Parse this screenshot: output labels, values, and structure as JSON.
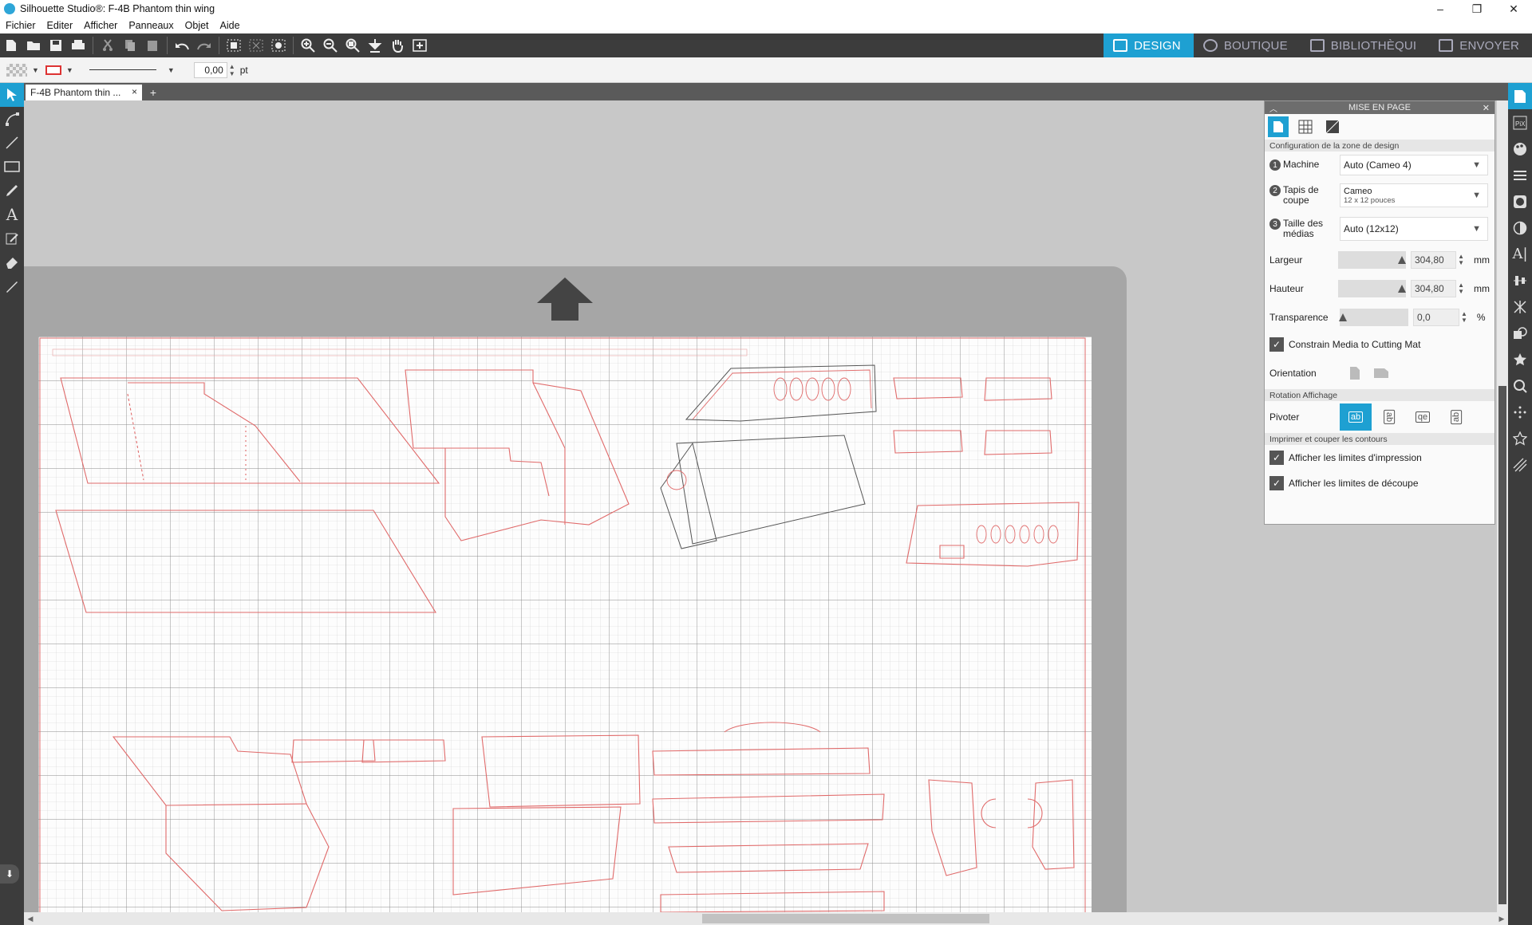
{
  "window": {
    "title": "Silhouette Studio®: F-4B Phantom thin wing",
    "controls": [
      "–",
      "❐",
      "✕"
    ]
  },
  "menu": [
    "Fichier",
    "Editer",
    "Afficher",
    "Panneaux",
    "Objet",
    "Aide"
  ],
  "nav": {
    "tabs": [
      {
        "label": "DESIGN",
        "active": true
      },
      {
        "label": "BOUTIQUE",
        "active": false
      },
      {
        "label": "BIBLIOTHÈQUI",
        "active": false
      },
      {
        "label": "ENVOYER",
        "active": false
      }
    ]
  },
  "properties": {
    "line_width": "0,00",
    "line_unit": "pt"
  },
  "document": {
    "tab_label": "F-4B Phantom thin ...",
    "close": "×",
    "add": "+"
  },
  "panel": {
    "title": "MISE EN PAGE",
    "section_design": "Configuration de la zone de design",
    "machine": {
      "step": "1",
      "label": "Machine",
      "value": "Auto (Cameo 4)"
    },
    "mat": {
      "step": "2",
      "label": "Tapis de coupe",
      "value": "Cameo",
      "sub": "12 x 12 pouces"
    },
    "media": {
      "step": "3",
      "label": "Taille des médias",
      "value": "Auto (12x12)"
    },
    "width": {
      "label": "Largeur",
      "value": "304,80",
      "unit": "mm"
    },
    "height": {
      "label": "Hauteur",
      "value": "304,80",
      "unit": "mm"
    },
    "transparency": {
      "label": "Transparence",
      "value": "0,0",
      "unit": "%"
    },
    "constrain": {
      "label": "Constrain Media to Cutting Mat",
      "checked": true
    },
    "orientation": {
      "label": "Orientation"
    },
    "section_rotation": "Rotation Affichage",
    "pivot": {
      "label": "Pivoter",
      "options": [
        "ab",
        "ab",
        "qe",
        "ab"
      ],
      "selected": 0
    },
    "section_print": "Imprimer et couper les contours",
    "show_print": {
      "label": "Afficher les limites d'impression",
      "checked": true
    },
    "show_cut": {
      "label": "Afficher les limites de découpe",
      "checked": true
    }
  },
  "colors": {
    "accent": "#1ea0d2",
    "toolbar": "#3c3c3c",
    "cut_line": "#e06a6a"
  }
}
